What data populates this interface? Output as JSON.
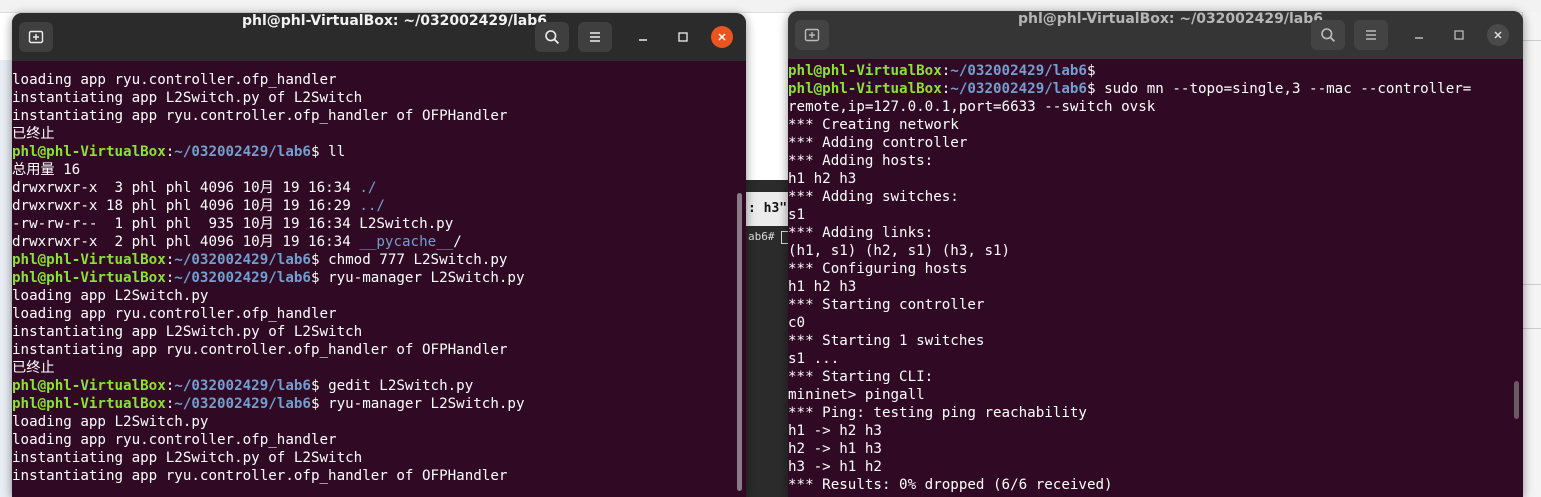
{
  "left_terminal": {
    "title": "phl@phl-VirtualBox: ~/032002429/lab6",
    "new_tab_icon": "new-tab-icon",
    "search_icon": "search-icon",
    "menu_icon": "hamburger-menu-icon",
    "lines": [
      {
        "type": "text",
        "text": "loading app ryu.controller.ofp_handler"
      },
      {
        "type": "text",
        "text": "instantiating app L2Switch.py of L2Switch"
      },
      {
        "type": "text",
        "text": "instantiating app ryu.controller.ofp_handler of OFPHandler"
      },
      {
        "type": "text",
        "text": "已终止"
      },
      {
        "type": "prompt",
        "user": "phl@phl-VirtualBox",
        "path": "~/032002429/lab6",
        "cmd": "ll"
      },
      {
        "type": "text",
        "text": "总用量 16"
      },
      {
        "type": "ls",
        "text": "drwxrwxr-x  3 phl phl 4096 10月 19 16:34 ",
        "name": "./"
      },
      {
        "type": "ls",
        "text": "drwxrwxr-x 18 phl phl 4096 10月 19 16:29 ",
        "name": "../"
      },
      {
        "type": "text",
        "text": "-rw-rw-r--  1 phl phl  935 10月 19 16:34 L2Switch.py"
      },
      {
        "type": "ls",
        "text": "drwxrwxr-x  2 phl phl 4096 10月 19 16:34 ",
        "name": "__pycache__",
        "suffix": "/"
      },
      {
        "type": "prompt",
        "user": "phl@phl-VirtualBox",
        "path": "~/032002429/lab6",
        "cmd": "chmod 777 L2Switch.py"
      },
      {
        "type": "prompt",
        "user": "phl@phl-VirtualBox",
        "path": "~/032002429/lab6",
        "cmd": "ryu-manager L2Switch.py"
      },
      {
        "type": "text",
        "text": "loading app L2Switch.py"
      },
      {
        "type": "text",
        "text": "loading app ryu.controller.ofp_handler"
      },
      {
        "type": "text",
        "text": "instantiating app L2Switch.py of L2Switch"
      },
      {
        "type": "text",
        "text": "instantiating app ryu.controller.ofp_handler of OFPHandler"
      },
      {
        "type": "text",
        "text": "已终止"
      },
      {
        "type": "prompt",
        "user": "phl@phl-VirtualBox",
        "path": "~/032002429/lab6",
        "cmd": "gedit L2Switch.py"
      },
      {
        "type": "prompt",
        "user": "phl@phl-VirtualBox",
        "path": "~/032002429/lab6",
        "cmd": "ryu-manager L2Switch.py"
      },
      {
        "type": "text",
        "text": "loading app L2Switch.py"
      },
      {
        "type": "text",
        "text": "loading app ryu.controller.ofp_handler"
      },
      {
        "type": "text",
        "text": "instantiating app L2Switch.py of L2Switch"
      },
      {
        "type": "text",
        "text": "instantiating app ryu.controller.ofp_handler of OFPHandler"
      }
    ]
  },
  "right_terminal": {
    "title": "phl@phl-VirtualBox: ~/032002429/lab6",
    "lines": [
      {
        "type": "prompt",
        "user": "phl@phl-VirtualBox",
        "path": "~/032002429/lab6",
        "cmd": ""
      },
      {
        "type": "prompt",
        "user": "phl@phl-VirtualBox",
        "path": "~/032002429/lab6",
        "cmd": "sudo mn --topo=single,3 --mac --controller="
      },
      {
        "type": "text",
        "text": "remote,ip=127.0.0.1,port=6633 --switch ovsk"
      },
      {
        "type": "text",
        "text": "*** Creating network"
      },
      {
        "type": "text",
        "text": "*** Adding controller"
      },
      {
        "type": "text",
        "text": "*** Adding hosts:"
      },
      {
        "type": "text",
        "text": "h1 h2 h3"
      },
      {
        "type": "text",
        "text": "*** Adding switches:"
      },
      {
        "type": "text",
        "text": "s1"
      },
      {
        "type": "text",
        "text": "*** Adding links:"
      },
      {
        "type": "text",
        "text": "(h1, s1) (h2, s1) (h3, s1)"
      },
      {
        "type": "text",
        "text": "*** Configuring hosts"
      },
      {
        "type": "text",
        "text": "h1 h2 h3"
      },
      {
        "type": "text",
        "text": "*** Starting controller"
      },
      {
        "type": "text",
        "text": "c0"
      },
      {
        "type": "text",
        "text": "*** Starting 1 switches"
      },
      {
        "type": "text",
        "text": "s1 ..."
      },
      {
        "type": "text",
        "text": "*** Starting CLI:"
      },
      {
        "type": "text",
        "text": "mininet> pingall"
      },
      {
        "type": "text",
        "text": "*** Ping: testing ping reachability"
      },
      {
        "type": "text",
        "text": "h1 -> h2 h3"
      },
      {
        "type": "text",
        "text": "h2 -> h1 h3"
      },
      {
        "type": "text",
        "text": "h3 -> h1 h2"
      },
      {
        "type": "text",
        "text": "*** Results: 0% dropped (6/6 received)"
      }
    ]
  },
  "background_terminal": {
    "title_fragment": ": h3\"",
    "prompt_fragment": "ab6# "
  },
  "colors": {
    "terminal_bg": "#300a24",
    "prompt_user": "#8ae234",
    "prompt_path": "#729fcf",
    "close_active": "#e95420"
  }
}
